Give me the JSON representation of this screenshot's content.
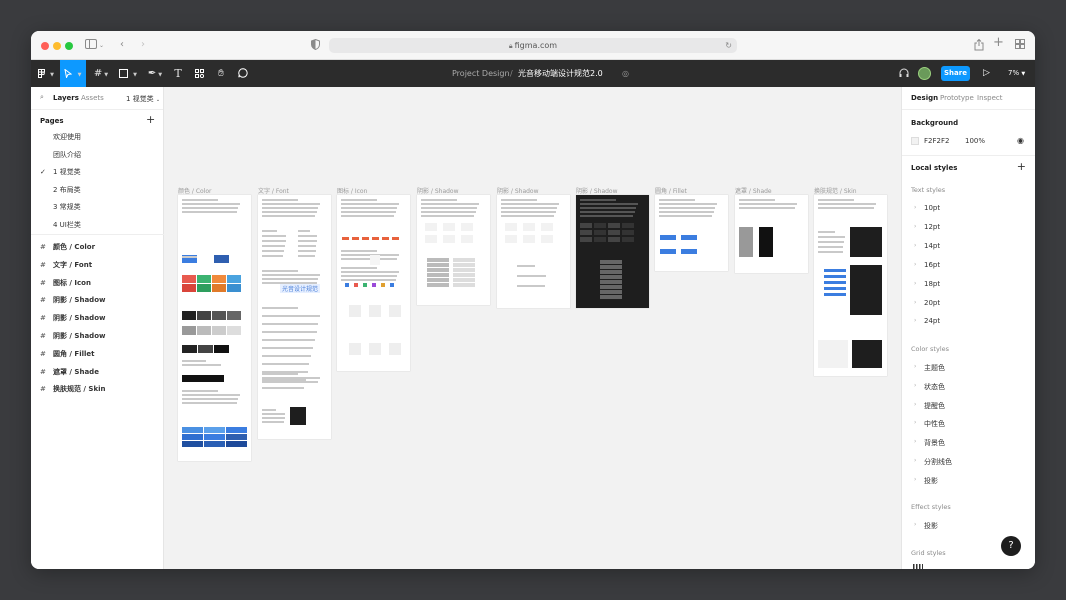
{
  "browser": {
    "url": "figma.com",
    "colors": {
      "close": "#ff5f57",
      "minimize": "#febc2e",
      "zoom": "#28c840"
    }
  },
  "toolbar": {
    "project": "Project Design",
    "separator": "/",
    "file_name": "光音移动端设计规范2.0",
    "share_label": "Share",
    "zoom": "7%",
    "accent": "#0d99ff"
  },
  "left_panel": {
    "tabs": [
      "Layers",
      "Assets"
    ],
    "current_page": "1 视觉类",
    "pages_header": "Pages",
    "pages": [
      "欢迎使用",
      "团队介绍",
      "1 视觉类",
      "2 布局类",
      "3 常规类",
      "4 UI栏类"
    ],
    "selected_page_index": 2,
    "layers": [
      "颜色 / Color",
      "文字 / Font",
      "图标 / Icon",
      "阴影 / Shadow",
      "阴影 / Shadow",
      "阴影 / Shadow",
      "圆角 / Fillet",
      "遮罩 / Shade",
      "换肤规范 / Skin"
    ]
  },
  "canvas": {
    "background": "#f2f2f2",
    "frames": [
      "颜色 / Color",
      "文字 / Font",
      "图标 / Icon",
      "阴影 / Shadow",
      "阴影 / Shadow",
      "阴影 / Shadow",
      "圆角 / Fillet",
      "遮罩 / Shade",
      "换肤规范 / Skin"
    ],
    "font_sample": "光音设计规范"
  },
  "right_panel": {
    "tabs": [
      "Design",
      "Prototype",
      "Inspect"
    ],
    "background_header": "Background",
    "background_hex": "F2F2F2",
    "background_opacity": "100%",
    "local_styles_header": "Local styles",
    "text_styles_header": "Text styles",
    "text_styles": [
      "10pt",
      "12pt",
      "14pt",
      "16pt",
      "18pt",
      "20pt",
      "24pt"
    ],
    "color_styles_header": "Color styles",
    "color_styles": [
      "主题色",
      "状态色",
      "提醒色",
      "中性色",
      "背景色",
      "分割线色",
      "投影"
    ],
    "effect_styles_header": "Effect styles",
    "effect_styles": [
      "投影"
    ],
    "grid_styles_header": "Grid styles",
    "help": "?"
  }
}
